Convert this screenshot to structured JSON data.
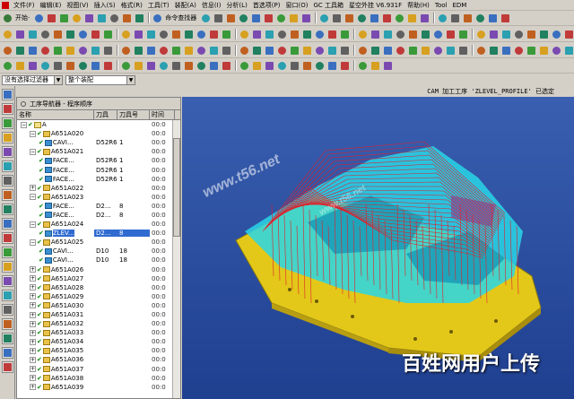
{
  "menubar": {
    "items": [
      "文件(F)",
      "编辑(E)",
      "视图(V)",
      "插入(S)",
      "格式(R)",
      "工具(T)",
      "装配(A)",
      "信息(I)",
      "分析(L)",
      "首选项(P)",
      "窗口(O)",
      "GC 工具箱",
      "星空外挂 V6.931F",
      "帮助(H)",
      "Tool",
      "EDM"
    ]
  },
  "toolbar": {
    "start_label": "开始·",
    "command_finder_label": "命令查找器"
  },
  "filters": {
    "selection_filter": "没有选择过滤器",
    "assembly_scope": "整个装配"
  },
  "status": {
    "message": "CAM 加工工序 'ZLEVEL_PROFILE' 已选定"
  },
  "navigator": {
    "title": "工序导航器 - 程序顺序",
    "columns": {
      "name": "名称",
      "tool": "刀具",
      "tool_number": "刀具号",
      "time": "时间"
    }
  },
  "tree_rows": [
    {
      "name": "A",
      "tool": "",
      "num": "",
      "time": "00:0"
    },
    {
      "name": "A651A020",
      "tool": "",
      "num": "",
      "time": "00:0"
    },
    {
      "name": "CAVI...",
      "tool": "D52R6",
      "num": "1",
      "time": "00:0"
    },
    {
      "name": "A651A021",
      "tool": "",
      "num": "",
      "time": "00:0"
    },
    {
      "name": "FACE...",
      "tool": "D52R6",
      "num": "1",
      "time": "00:0"
    },
    {
      "name": "FACE...",
      "tool": "D52R6",
      "num": "1",
      "time": "00:0"
    },
    {
      "name": "FACE...",
      "tool": "D52R6",
      "num": "1",
      "time": "00:0"
    },
    {
      "name": "A651A022",
      "tool": "",
      "num": "",
      "time": "00:0"
    },
    {
      "name": "A651A023",
      "tool": "",
      "num": "",
      "time": "00:0"
    },
    {
      "name": "FACE...",
      "tool": "D2...",
      "num": "8",
      "time": "00:0"
    },
    {
      "name": "FACE...",
      "tool": "D2...",
      "num": "8",
      "time": "00:0"
    },
    {
      "name": "A651A024",
      "tool": "",
      "num": "",
      "time": "00:0"
    },
    {
      "name": "ZLEV...",
      "tool": "D2...",
      "num": "8",
      "time": "00:0"
    },
    {
      "name": "A651A025",
      "tool": "",
      "num": "",
      "time": "00:0"
    },
    {
      "name": "CAVI...",
      "tool": "D10",
      "num": "18",
      "time": "00:0"
    },
    {
      "name": "CAVI...",
      "tool": "D10",
      "num": "18",
      "time": "00:0"
    },
    {
      "name": "A651A026",
      "tool": "",
      "num": "",
      "time": "00:0"
    },
    {
      "name": "A651A027",
      "tool": "",
      "num": "",
      "time": "00:0"
    },
    {
      "name": "A651A028",
      "tool": "",
      "num": "",
      "time": "00:0"
    },
    {
      "name": "A651A029",
      "tool": "",
      "num": "",
      "time": "00:0"
    },
    {
      "name": "A651A030",
      "tool": "",
      "num": "",
      "time": "00:0"
    },
    {
      "name": "A651A031",
      "tool": "",
      "num": "",
      "time": "00:0"
    },
    {
      "name": "A651A032",
      "tool": "",
      "num": "",
      "time": "00:0"
    },
    {
      "name": "A651A033",
      "tool": "",
      "num": "",
      "time": "00:0"
    },
    {
      "name": "A651A034",
      "tool": "",
      "num": "",
      "time": "00:0"
    },
    {
      "name": "A651A035",
      "tool": "",
      "num": "",
      "time": "00:0"
    },
    {
      "name": "A651A036",
      "tool": "",
      "num": "",
      "time": "00:0"
    },
    {
      "name": "A651A037",
      "tool": "",
      "num": "",
      "time": "00:0"
    },
    {
      "name": "A651A038",
      "tool": "",
      "num": "",
      "time": "00:0"
    },
    {
      "name": "A651A039",
      "tool": "",
      "num": "",
      "time": "00:0"
    }
  ],
  "watermarks": {
    "site": "www.t56.net",
    "site2": "www.t56.net",
    "bottom": "百姓网用户上传"
  },
  "colors": {
    "viewport_bg": "#2a4fa0",
    "part_body": "#e3c81a",
    "toolpath_cyan": "#29d6e8",
    "toolpath_red": "#e0202a",
    "selection_blue": "#2f6ad0"
  }
}
